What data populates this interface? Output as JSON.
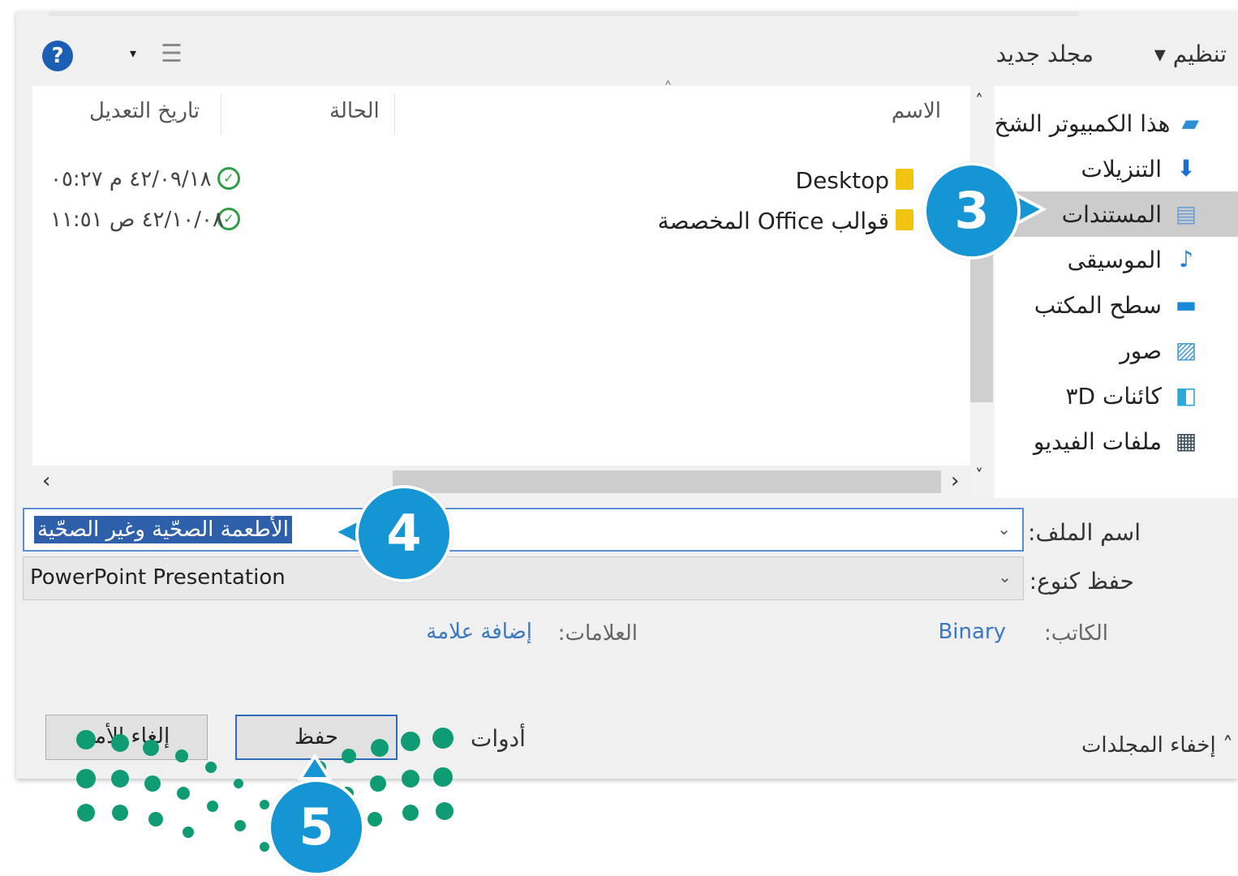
{
  "toolbar": {
    "organize_label": "تنظيم ▾",
    "new_folder_label": "مجلد جديد",
    "help_icon": "?",
    "view_caret": "▾"
  },
  "navigation": {
    "items": [
      {
        "label": "هذا الكمبيوتر الشخ",
        "icon": "pc-icon"
      },
      {
        "label": "التنزيلات",
        "icon": "download-icon"
      },
      {
        "label": "المستندات",
        "icon": "document-icon",
        "selected": true
      },
      {
        "label": "الموسيقى",
        "icon": "music-icon"
      },
      {
        "label": "سطح المكتب",
        "icon": "desktop-icon"
      },
      {
        "label": "صور",
        "icon": "pictures-icon"
      },
      {
        "label": "كائنات ٣D",
        "icon": "cube-icon"
      },
      {
        "label": "ملفات الفيديو",
        "icon": "video-icon"
      }
    ]
  },
  "file_list": {
    "columns": {
      "name": "الاسم",
      "status": "الحالة",
      "modified": "تاريخ التعديل"
    },
    "rows": [
      {
        "name": "Desktop",
        "date": "٤٢/٠٩/١٨ م ٠٥:٢٧"
      },
      {
        "name": "قوالب Office المخصصة",
        "date": "٤٢/١٠/٠٨ ص ١١:٥١"
      }
    ]
  },
  "form": {
    "filename_label": "اسم الملف:",
    "filename_value": "الأطعمة الصحّية وغير الصحّية",
    "savetype_label": "حفظ كنوع:",
    "savetype_value": "PowerPoint Presentation",
    "author_label": "الكاتب:",
    "author_value": "Binary",
    "tags_label": "العلامات:",
    "tags_value": "إضافة علامة"
  },
  "footer": {
    "hide_folders_label": "إخفاء المجلدات",
    "tools_label": "أدوات",
    "save_label": "حفظ",
    "cancel_label": "إلغاء الأمر"
  },
  "callouts": [
    "3",
    "4",
    "5"
  ],
  "colors": {
    "callout": "#1595d3",
    "dots": "#0f9c74",
    "selection": "#2e5faa",
    "link": "#3a78c3"
  }
}
